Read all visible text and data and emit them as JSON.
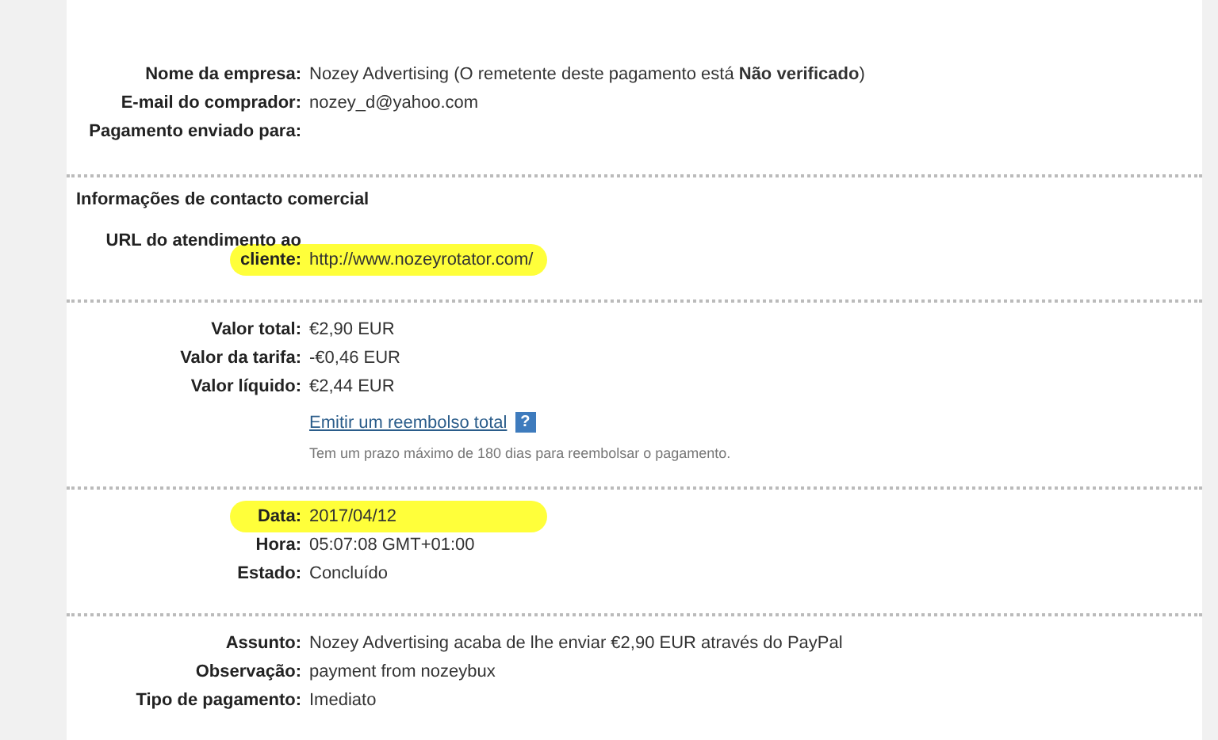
{
  "sections": [
    {
      "rows": [
        {
          "kind": "field",
          "label": "Nome da empresa:",
          "value": "Nozey Advertising (O remetente deste pagamento está **Não verificado**)",
          "highlighted": false
        },
        {
          "kind": "field",
          "label": "E-mail do comprador:",
          "value": "nozey_d@yahoo.com",
          "highlighted": false
        },
        {
          "kind": "field",
          "label": "Pagamento enviado para:",
          "highlighted": false
        }
      ]
    },
    {
      "heading": "Informações de contacto comercial",
      "rows": [
        {
          "kind": "field",
          "label": "URL do atendimento ao cliente:",
          "value": "http://www.nozeyrotator.com/",
          "highlighted": true
        }
      ]
    },
    {
      "rows": [
        {
          "kind": "field",
          "label": "Valor total:",
          "value": "€2,90 EUR",
          "highlighted": false
        },
        {
          "kind": "field",
          "label": "Valor da tarifa:",
          "value": "-€0,46 EUR",
          "highlighted": false
        },
        {
          "kind": "field",
          "label": "Valor líquido:",
          "value": "€2,44 EUR",
          "highlighted": false
        },
        {
          "kind": "link",
          "value": "Emitir um reembolso total",
          "help": "?"
        },
        {
          "kind": "note",
          "value": "Tem um prazo máximo de 180 dias para reembolsar o pagamento."
        }
      ]
    },
    {
      "rows": [
        {
          "kind": "field",
          "label": "Data:",
          "value": "2017/04/12",
          "highlighted": true
        },
        {
          "kind": "field",
          "label": "Hora:",
          "value": "05:07:08 GMT+01:00",
          "highlighted": false
        },
        {
          "kind": "field",
          "label": "Estado:",
          "value": "Concluído",
          "highlighted": false
        }
      ]
    },
    {
      "rows": [
        {
          "kind": "field",
          "label": "Assunto:",
          "value": "Nozey Advertising acaba de lhe enviar €2,90 EUR através do PayPal",
          "highlighted": false
        },
        {
          "kind": "field",
          "label": "Observação:",
          "value": "payment from nozeybux",
          "highlighted": false
        },
        {
          "kind": "field",
          "label": "Tipo de pagamento:",
          "value": "Imediato",
          "highlighted": false
        }
      ]
    }
  ]
}
